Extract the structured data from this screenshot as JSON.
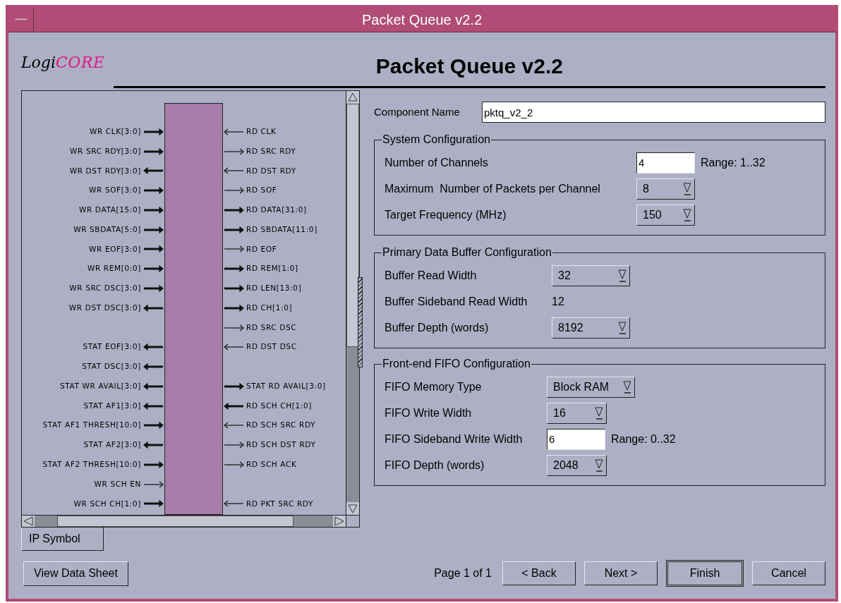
{
  "window": {
    "title": "Packet Queue v2.2"
  },
  "logo": {
    "prefix": "Logi",
    "suffix": "CORE"
  },
  "heading": "Packet Queue v2.2",
  "symbol": {
    "rows": [
      {
        "left": {
          "label": "WR CLK[3:0]",
          "input": true,
          "bus": true
        },
        "right": {
          "label": "RD CLK",
          "input": true,
          "bus": false
        }
      },
      {
        "left": {
          "label": "WR SRC RDY[3:0]",
          "input": true,
          "bus": true
        },
        "right": {
          "label": "RD SRC RDY",
          "input": false,
          "bus": false
        }
      },
      {
        "left": {
          "label": "WR DST RDY[3:0]",
          "input": false,
          "bus": true
        },
        "right": {
          "label": "RD DST RDY",
          "input": true,
          "bus": false
        }
      },
      {
        "left": {
          "label": "WR SOF[3:0]",
          "input": true,
          "bus": true
        },
        "right": {
          "label": "RD SOF",
          "input": false,
          "bus": false
        }
      },
      {
        "left": {
          "label": "WR DATA[15:0]",
          "input": true,
          "bus": true
        },
        "right": {
          "label": "RD DATA[31:0]",
          "input": false,
          "bus": true
        }
      },
      {
        "left": {
          "label": "WR SBDATA[5:0]",
          "input": true,
          "bus": true
        },
        "right": {
          "label": "RD SBDATA[11:0]",
          "input": false,
          "bus": true
        }
      },
      {
        "left": {
          "label": "WR EOF[3:0]",
          "input": true,
          "bus": true
        },
        "right": {
          "label": "RD EOF",
          "input": false,
          "bus": false
        }
      },
      {
        "left": {
          "label": "WR REM[0:0]",
          "input": true,
          "bus": true
        },
        "right": {
          "label": "RD REM[1:0]",
          "input": false,
          "bus": true
        }
      },
      {
        "left": {
          "label": "WR SRC DSC[3:0]",
          "input": true,
          "bus": true
        },
        "right": {
          "label": "RD LEN[13:0]",
          "input": false,
          "bus": true
        }
      },
      {
        "left": {
          "label": "WR DST DSC[3:0]",
          "input": false,
          "bus": true
        },
        "right": {
          "label": "RD CH[1:0]",
          "input": false,
          "bus": true
        }
      },
      {
        "right": {
          "label": "RD SRC DSC",
          "input": false,
          "bus": false
        }
      },
      {
        "left": {
          "label": "STAT EOF[3:0]",
          "input": false,
          "bus": true
        },
        "right": {
          "label": "RD DST DSC",
          "input": true,
          "bus": false
        }
      },
      {
        "left": {
          "label": "STAT DSC[3:0]",
          "input": false,
          "bus": true
        }
      },
      {
        "left": {
          "label": "STAT WR AVAIL[3:0]",
          "input": false,
          "bus": true
        },
        "right": {
          "label": "STAT RD AVAIL[3:0]",
          "input": false,
          "bus": true
        }
      },
      {
        "left": {
          "label": "STAT AF1[3:0]",
          "input": false,
          "bus": true
        },
        "right": {
          "label": "RD SCH CH[1:0]",
          "input": true,
          "bus": true
        }
      },
      {
        "left": {
          "label": "STAT AF1 THRESH[10:0]",
          "input": true,
          "bus": true
        },
        "right": {
          "label": "RD SCH SRC RDY",
          "input": true,
          "bus": false
        }
      },
      {
        "left": {
          "label": "STAT AF2[3:0]",
          "input": false,
          "bus": true
        },
        "right": {
          "label": "RD SCH DST RDY",
          "input": false,
          "bus": false
        }
      },
      {
        "left": {
          "label": "STAT AF2 THRESH[10:0]",
          "input": true,
          "bus": true
        },
        "right": {
          "label": "RD SCH ACK",
          "input": false,
          "bus": false
        }
      },
      {
        "left": {
          "label": "WR SCH EN",
          "input": true,
          "bus": false
        }
      },
      {
        "left": {
          "label": "WR SCH CH[1:0]",
          "input": true,
          "bus": true
        },
        "right": {
          "label": "RD PKT SRC RDY",
          "input": true,
          "bus": false
        }
      }
    ]
  },
  "tabs": [
    {
      "label": "IP Symbol",
      "selected": true
    }
  ],
  "component_name": {
    "label": "Component Name",
    "value": "pktq_v2_2"
  },
  "groups": [
    {
      "title": "System Configuration",
      "rows": [
        {
          "label": "Number of Channels",
          "kind": "text",
          "value": "4",
          "hint": "Range: 1..32"
        },
        {
          "label": "Maximum  Number of Packets per Channel",
          "kind": "dropdown",
          "value": "8"
        },
        {
          "label": "Target Frequency (MHz)",
          "kind": "dropdown",
          "value": "150"
        }
      ]
    },
    {
      "title": "Primary Data Buffer Configuration",
      "rows": [
        {
          "label": "Buffer Read Width",
          "kind": "dropdown",
          "value": "32"
        },
        {
          "label": "Buffer Sideband Read Width",
          "kind": "value",
          "value": "12"
        },
        {
          "label": "Buffer Depth (words)",
          "kind": "dropdown",
          "value": "8192"
        }
      ]
    },
    {
      "title": "Front-end FIFO Configuration",
      "rows": [
        {
          "label": "FIFO Memory Type",
          "kind": "dropdown",
          "value": "Block RAM"
        },
        {
          "label": "FIFO Write Width",
          "kind": "dropdown",
          "value": "16"
        },
        {
          "label": "FIFO Sideband Write Width",
          "kind": "text",
          "value": "6",
          "hint": "Range: 0..32"
        },
        {
          "label": "FIFO Depth (words)",
          "kind": "dropdown",
          "value": "2048"
        }
      ]
    }
  ],
  "data_sheet_button": "View Data Sheet",
  "page_indicator": "Page 1 of 1",
  "nav_buttons": [
    {
      "label": "< Back",
      "default": false
    },
    {
      "label": "Next >",
      "default": false
    },
    {
      "label": "Finish",
      "default": true
    },
    {
      "label": "Cancel",
      "default": false
    }
  ]
}
